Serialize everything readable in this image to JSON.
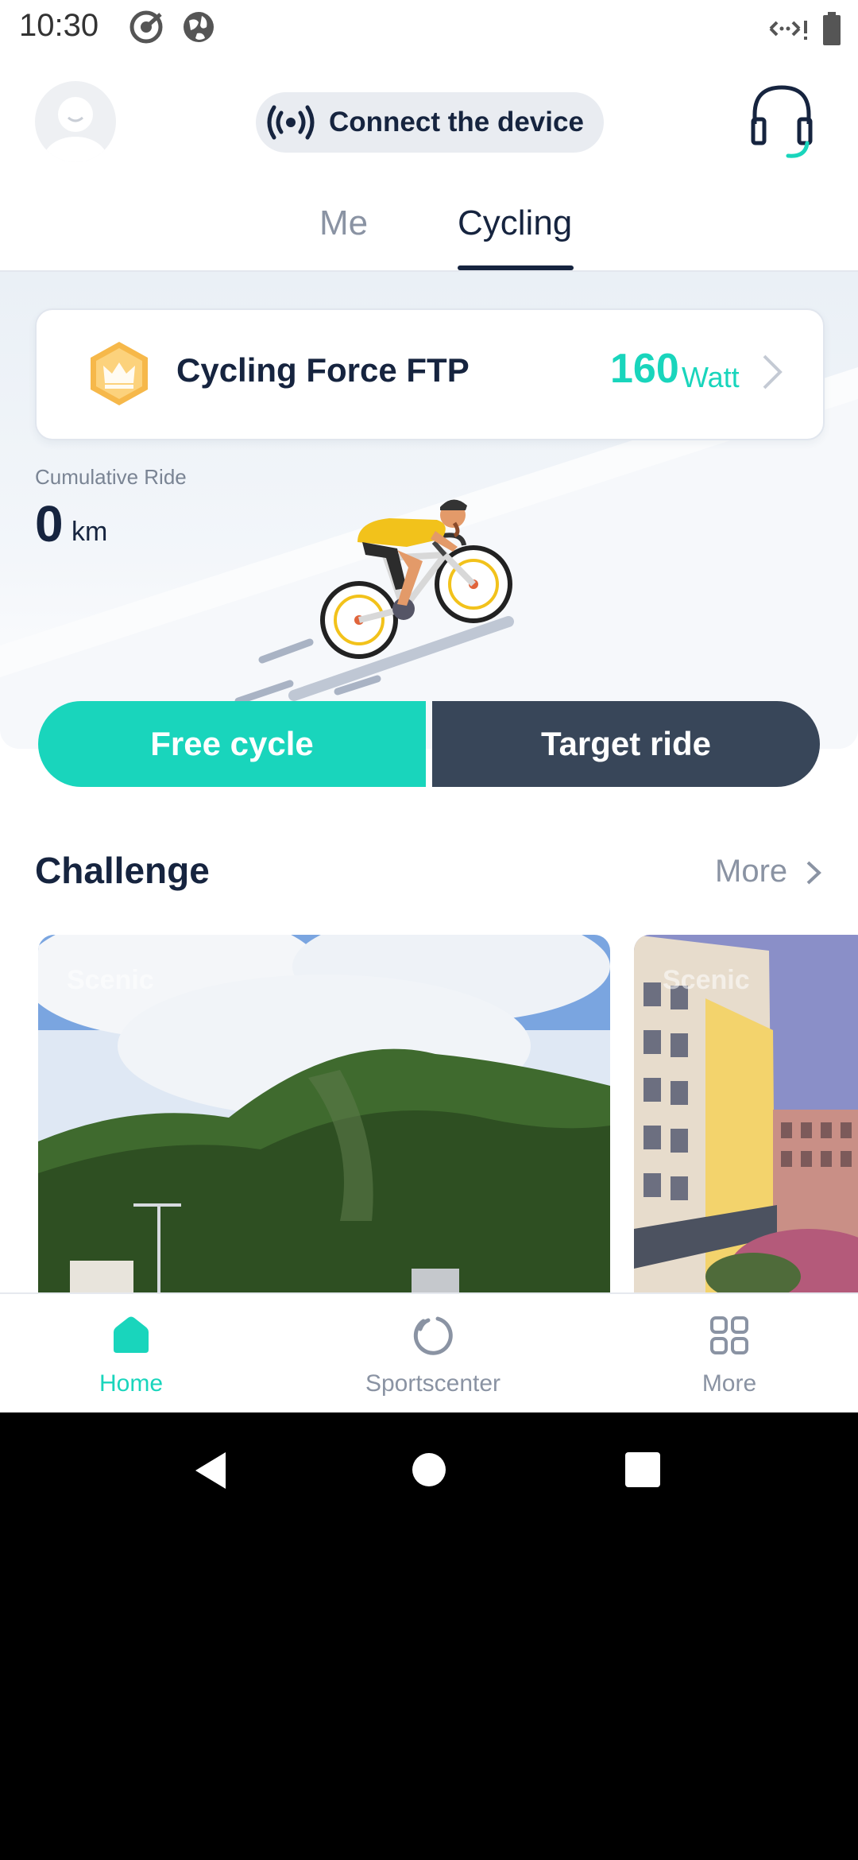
{
  "status_bar": {
    "time": "10:30"
  },
  "header": {
    "connect_label": "Connect the device"
  },
  "tabs": [
    {
      "label": "Me",
      "selected": false
    },
    {
      "label": "Cycling",
      "selected": true
    }
  ],
  "ftp_card": {
    "label": "Cycling Force FTP",
    "value": "160",
    "unit": "Watt"
  },
  "cumulative": {
    "label": "Cumulative Ride",
    "value": "0",
    "unit": "km"
  },
  "buttons": {
    "free": "Free cycle",
    "target": "Target ride"
  },
  "challenge": {
    "title": "Challenge",
    "more": "More",
    "cards": [
      {
        "tag": "Scenic"
      },
      {
        "tag": "Scenic"
      }
    ]
  },
  "bottom_nav": [
    {
      "label": "Home",
      "active": true
    },
    {
      "label": "Sportscenter",
      "active": false
    },
    {
      "label": "More",
      "active": false
    }
  ],
  "colors": {
    "accent": "#19d5bc",
    "dark": "#16243f",
    "target_button": "#384659",
    "muted": "#8a93a3"
  },
  "icons": [
    "target-icon",
    "globe-icon",
    "data-transfer-icon",
    "battery-icon",
    "broadcast-icon",
    "headset-icon",
    "crown-icon",
    "chevron-right-icon",
    "home-icon",
    "sportscenter-icon",
    "grid-icon",
    "back-icon",
    "home-circle-icon",
    "recents-icon"
  ]
}
